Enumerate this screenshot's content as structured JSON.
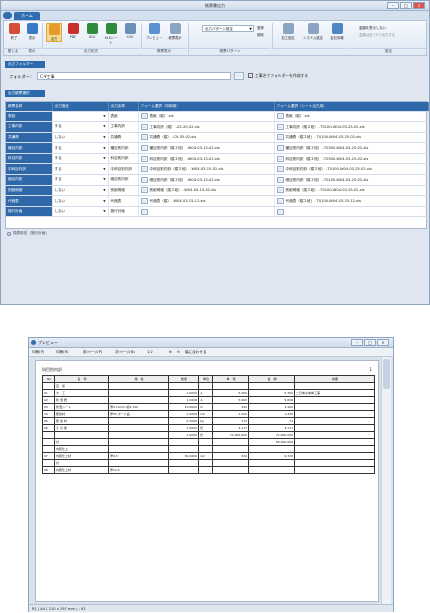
{
  "main": {
    "title": "帳票書出力",
    "tab": "ホーム",
    "ribbon": {
      "buttons": [
        "終了",
        "表示",
        "出力",
        "PDF",
        "XLS",
        "XLSシート",
        "CSV",
        "プレビュー",
        "帳票表示"
      ],
      "groups": [
        "閉じる",
        "表示",
        "出力形式",
        "帳票表示",
        "帳票パターン",
        "",
        "設定"
      ],
      "pattern_select": "出力パターン設定",
      "pattern_actions": [
        "登録",
        "削除"
      ],
      "settings": [
        "加工設定",
        "システム設定",
        "会社情報"
      ],
      "notice_line1": "金額を表示しない",
      "notice_line2": "金額は全て0で出力する"
    },
    "folder_section": "出力フォルダー",
    "folder_label": "フォルダー：",
    "folder_value": "C:¥工事",
    "folder_check_label": "工事名でフォルダーを作成する",
    "form_section": "出力帳票選択",
    "columns": [
      "帳票名称",
      "出力指定",
      "出力名称",
      "フォーム選択（印刷用）",
      "フォーム選択（シート出力用）"
    ],
    "rows": [
      {
        "name": "表紙",
        "spec": "",
        "out": "表紙",
        "form": "表紙（縦）.xls",
        "sheet": "表紙（縦）.xls"
      },
      {
        "name": "工事内訳",
        "spec": "する",
        "out": "工事内訳",
        "form": "工事内訳（縦） -02-20-02.xls",
        "sheet": "工事内訳（縦２段） -T0100-W04-03-25-02.xls"
      },
      {
        "name": "共通費",
        "spec": "しない",
        "out": "共通費",
        "form": "共通費（縦） -C9-35-02.xls",
        "sheet": "共通費（縦２段） -T0100-W04-03-25-02.xls"
      },
      {
        "name": "種目内訳",
        "spec": "する",
        "out": "種目別内訳",
        "form": "種目別内訳（縦２段） -W04-03-15-02.xls",
        "sheet": "種目別内訳（縦２段） -T0300-W04-03-25-02.xls"
      },
      {
        "name": "科目内訳",
        "spec": "する",
        "out": "科目別内訳",
        "form": "科目別内訳（縦２段） -W04-03-15-02.xls",
        "sheet": "科目別内訳（縦２段） -T0300-W04-03-25-02.xls"
      },
      {
        "name": "中科目内訳",
        "spec": "する",
        "out": "中科目別内訳",
        "form": "中科目別内訳（縦２段） -W04-03-15-02.xls",
        "sheet": "中科目別内訳（縦２段） -T0100-W04-03-25-02.xls"
      },
      {
        "name": "細目内訳",
        "spec": "する",
        "out": "細目別内訳",
        "form": "細目別内訳（縦２段） -W04-03-15-02.xls",
        "sheet": "細目別内訳（縦２段） -T0100-W04-03-25-02.xls"
      },
      {
        "name": "別紙明細",
        "spec": "しない",
        "out": "別紙明細",
        "form": "別紙明細（縦２段） -W04-03-15-02.xls",
        "sheet": "別紙明細（縦２段） -T0100-W04-03-25-02.xls"
      },
      {
        "name": "代価表",
        "spec": "しない",
        "out": "代価表",
        "form": "代価表（縦） -W04-03-15-12.xls",
        "sheet": "代価表（縦２段） -T0100-W04-03-25-12.xls"
      },
      {
        "name": "施行計画",
        "spec": "しない",
        "out": "施行計画",
        "form": "",
        "sheet": ""
      }
    ],
    "footer_note": "換算設定（施行計画）"
  },
  "preview": {
    "title": "プレビュー",
    "toolbar": [
      "印刷(P)",
      "印刷(R)",
      "前ページ(P)",
      "次ページ(N)",
      "1/2",
      "幅に合わせる"
    ],
    "status": "R1 | A4 ( 210 x 297 mm ) : 92",
    "doc_title": "科目別内訳",
    "doc_page": "1",
    "doc_headers": [
      "No",
      "名　称",
      "規　格",
      "数量",
      "単位",
      "単　価",
      "金　額",
      "摘要"
    ],
    "doc_rows": [
      {
        "no": "",
        "name": "直　仮",
        "spec": "",
        "qty": "",
        "unit": "",
        "price": "",
        "amt": "",
        "note": ""
      },
      {
        "no": "01",
        "name": "大　工",
        "spec": "",
        "qty": "1.0000",
        "unit": "人",
        "price": "5,300",
        "amt": "5,300",
        "note": "二日本の本体工事"
      },
      {
        "no": "02",
        "name": "防 湿 層",
        "spec": "",
        "qty": "1.0000",
        "unit": "人",
        "price": "5,000",
        "amt": "5,000",
        "note": ""
      },
      {
        "no": "03",
        "name": "防湿シート",
        "spec": "厚0.15mm 幅1,700",
        "qty": "10.0000",
        "unit": "m",
        "price": "340",
        "amt": "3,400",
        "note": ""
      },
      {
        "no": "04",
        "name": "断熱材",
        "spec": "厚50 ボード品",
        "qty": "1.0000",
        "unit": "m2",
        "price": "1,420",
        "amt": "1,420",
        "note": ""
      },
      {
        "no": "05",
        "name": "断 熱 材",
        "spec": "",
        "qty": "0.1000",
        "unit": "kg",
        "price": "712",
        "amt": "71",
        "note": ""
      },
      {
        "no": "06",
        "name": "そ の 他",
        "spec": "",
        "qty": "1.0000",
        "unit": "式",
        "price": "3,117",
        "amt": "3,117",
        "note": ""
      },
      {
        "no": "",
        "name": "",
        "spec": "",
        "qty": "1.0000",
        "unit": "式",
        "price": "71,000,000",
        "amt": "71,000,000",
        "note": ""
      },
      {
        "no": "",
        "name": "計",
        "spec": "",
        "qty": "",
        "unit": "",
        "price": "",
        "amt": "85,000,000",
        "note": ""
      },
      {
        "no": "",
        "name": "内装仕上",
        "spec": "",
        "qty": "",
        "unit": "",
        "price": "",
        "amt": "",
        "note": ""
      },
      {
        "no": "07",
        "name": "内装仕上材",
        "spec": "厚9.5",
        "qty": "30.0000",
        "unit": "m2",
        "price": "324",
        "amt": "9,720",
        "note": ""
      },
      {
        "no": "",
        "name": "計",
        "spec": "",
        "qty": "",
        "unit": "",
        "price": "",
        "amt": "",
        "note": ""
      },
      {
        "no": "08",
        "name": "内装仕上材",
        "spec": "厚12.5",
        "qty": "",
        "unit": "",
        "price": "",
        "amt": "",
        "note": ""
      }
    ]
  }
}
